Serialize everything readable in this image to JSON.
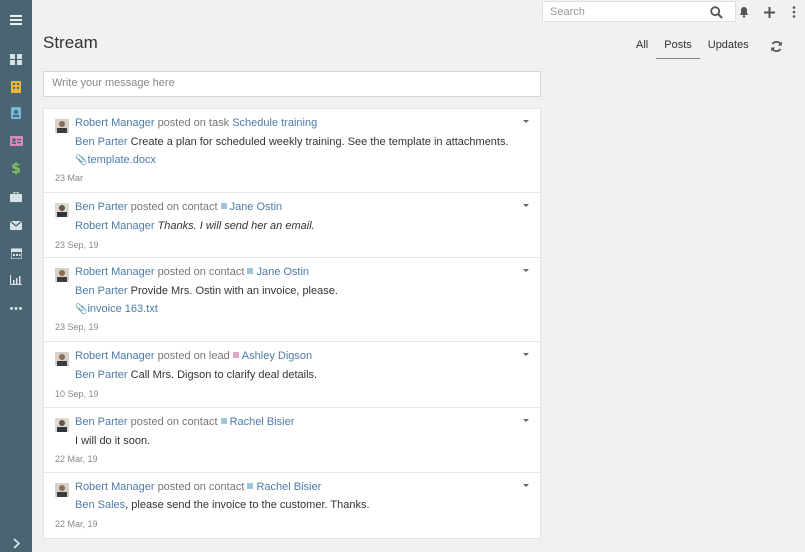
{
  "app": {
    "sidebar": {
      "items": [
        {
          "name": "menu-icon",
          "color": "#e8eef0"
        },
        {
          "name": "dashboard-icon",
          "color": "#d8e2e6"
        },
        {
          "name": "building-icon",
          "color": "#e6b73a"
        },
        {
          "name": "contact-card-icon",
          "color": "#74b8d9"
        },
        {
          "name": "lead-card-icon",
          "color": "#d78ab3"
        },
        {
          "name": "dollar-icon",
          "color": "#7fc45a"
        },
        {
          "name": "briefcase-icon",
          "color": "#d8e2e6"
        },
        {
          "name": "envelope-icon",
          "color": "#d8e2e6"
        },
        {
          "name": "calendar-icon",
          "color": "#d8e2e6"
        },
        {
          "name": "chart-icon",
          "color": "#d8e2e6"
        },
        {
          "name": "more-icon",
          "color": "#d8e2e6"
        },
        {
          "name": "chevron-right-icon",
          "color": "#e8eef0"
        }
      ]
    }
  },
  "topbar": {
    "search_placeholder": "Search"
  },
  "page": {
    "title": "Stream",
    "filters": [
      "All",
      "Posts",
      "Updates"
    ],
    "active_filter": "Posts",
    "message_placeholder": "Write your message here"
  },
  "colors": {
    "link": "#4d7ba8",
    "contact_square": "#9fc7db",
    "lead_square": "#e1a6c5"
  },
  "posts": [
    {
      "author": "Robert Manager",
      "action": "posted on task",
      "target": "Schedule training",
      "target_type": "task",
      "to": "Ben Parter",
      "text": "Create a plan for scheduled weekly training. See the template in attachments.",
      "attachment": "template.docx",
      "date": "23 Mar"
    },
    {
      "author": "Ben Parter",
      "action": "posted on contact",
      "target": "Jane Ostin",
      "target_type": "contact",
      "to": "Robert Manager",
      "text": "Thanks. I will send her an email.",
      "date": "23 Sep, 19"
    },
    {
      "author": "Robert Manager",
      "action": "posted on contact",
      "target": "Jane Ostin",
      "target_type": "contact",
      "to": "Ben Parter",
      "text": "Provide Mrs. Ostin with an invoice, please.",
      "attachment": "invoice 163.txt",
      "date": "23 Sep, 19"
    },
    {
      "author": "Robert Manager",
      "action": "posted on lead",
      "target": "Ashley Digson",
      "target_type": "lead",
      "to": "Ben Parter",
      "text": "Call Mrs. Digson to clarify deal details.",
      "date": "10 Sep, 19"
    },
    {
      "author": "Ben Parter",
      "action": "posted on contact",
      "target": "Rachel Bisier",
      "target_type": "contact",
      "text": "I will do it soon.",
      "date": "22 Mar, 19"
    },
    {
      "author": "Robert Manager",
      "action": "posted on contact",
      "target": "Rachel Bisier",
      "target_type": "contact",
      "to": "Ben Sales",
      "text": ", please send the invoice to the customer. Thanks.",
      "date": "22 Mar, 19"
    }
  ]
}
